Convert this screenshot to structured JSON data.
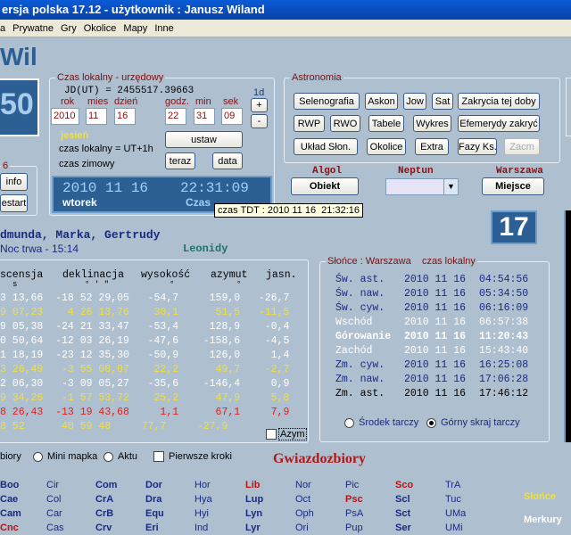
{
  "title": "ersja polska 17.12 - użytkownik : Janusz Wiland",
  "menu": [
    "a",
    "Prywatne",
    "Gry",
    "Okolice",
    "Mapy",
    "Inne"
  ],
  "logo": "Wil",
  "big_num": "50",
  "side_num": "6",
  "side_btns": [
    "info",
    "estart"
  ],
  "local_time": {
    "label": "Czas lokalny - urzędowy",
    "jd": "JD(UT)  =  2455517.39663",
    "rok": "rok",
    "mies": "mies",
    "dzien": "dzień",
    "godz": "godz.",
    "min": "min",
    "sek": "sek",
    "step": "1d",
    "year": "2010",
    "month": "11",
    "day": "16",
    "hour": "22",
    "minute": "31",
    "second": "09",
    "season": "jesień",
    "ut": "czas lokalny = UT+1h",
    "winter": "czas zimowy",
    "set_btn": "ustaw",
    "now_btn": "teraz",
    "date_btn": "data",
    "plus": "+",
    "minus": "-"
  },
  "display": {
    "date": "2010 11 16",
    "time": "22:31:09",
    "weekday": "wtorek",
    "tail": "Czas"
  },
  "tooltip": "czas TDT : 2010 11 16  21:32:16",
  "astro": {
    "label": "Astronomia",
    "row1": [
      "Selenografia",
      "Askon",
      "Jow",
      "Sat",
      "Zakrycia tej doby"
    ],
    "row2": [
      "RWP",
      "RWO",
      "Tabele",
      "Wykres",
      "Efemerydy zakryć"
    ],
    "row3": [
      "Układ Słon.",
      "Okolice",
      "Extra",
      "Fazy Ks.",
      "Zacm"
    ]
  },
  "selectors": {
    "algol": "Algol",
    "obiekt": "Obiekt",
    "neptun": "Neptun",
    "warszawa": "Warszawa",
    "miejsce": "Miejsce",
    "day_box": "17"
  },
  "names": "dmunda, Marka, Gertrudy",
  "night": "Noc trwa - 15:14",
  "leonidy": "Leonidy",
  "table": {
    "headers": [
      "scensja",
      "deklinacja",
      "wysokość",
      "azymut",
      "jasn."
    ],
    "units": [
      "s",
      "°  '  \"",
      "°",
      "°",
      ""
    ],
    "rows": [
      {
        "c": "#fff",
        "t": "3 13,66  -18 52 29,05   -54,7     159,0   -26,7"
      },
      {
        "c": "#f0e040",
        "t": "9 07,23    4 26 13,76    30,1      51,5   -11,5"
      },
      {
        "c": "#fff",
        "t": "9 05,38  -24 21 33,47   -53,4     128,9    -0,4"
      },
      {
        "c": "#fff",
        "t": "0 50,64  -12 03 26,19   -47,6    -158,6    -4,5"
      },
      {
        "c": "#fff",
        "t": "1 18,19  -23 12 35,30   -50,9     126,0     1,4"
      },
      {
        "c": "#f0e040",
        "t": "3 26,49   -3 55 08,07    22,2      49,7    -2,7"
      },
      {
        "c": "#fff",
        "t": "2 06,30   -3 09 05,27   -35,6    -146,4     0,9"
      },
      {
        "c": "#f0e040",
        "t": "9 34,26   -1 57 53,72    25,2      47,9     5,8"
      },
      {
        "c": "#e02020",
        "t": "8 26,43  -13 19 43,68     1,1      67,1     7,9"
      },
      {
        "c": "#f0e040",
        "t": "8 52      40 59 48     77,7     -27,9"
      }
    ],
    "azym": "Azym"
  },
  "sun": {
    "label": "Słońce : Warszawa    czas lokalny",
    "rows": [
      {
        "n": "Św. ast.",
        "d": "2010 11 16",
        "t": "04:54:56",
        "c": "#1a2a80"
      },
      {
        "n": "Św. naw.",
        "d": "2010 11 16",
        "t": "05:34:50",
        "c": "#1a2a80"
      },
      {
        "n": "Św. cyw.",
        "d": "2010 11 16",
        "t": "06:16:09",
        "c": "#1a2a80"
      },
      {
        "n": "Wschód",
        "d": "2010 11 16",
        "t": "06:57:38",
        "c": "#fff"
      },
      {
        "n": "Górowanie",
        "d": "2010 11 16",
        "t": "11:20:43",
        "c": "#fff",
        "b": true
      },
      {
        "n": "Zachód",
        "d": "2010 11 16",
        "t": "15:43:40",
        "c": "#fff"
      },
      {
        "n": "Zm. cyw.",
        "d": "2010 11 16",
        "t": "16:25:08",
        "c": "#1a2a80"
      },
      {
        "n": "Zm. naw.",
        "d": "2010 11 16",
        "t": "17:06:28",
        "c": "#1a2a80"
      },
      {
        "n": "Zm. ast.",
        "d": "2010 11 16",
        "t": "17:46:12",
        "c": "#000"
      }
    ],
    "radio1": "Środek tarczy",
    "radio2": "Górny skraj tarczy"
  },
  "bottom": {
    "b1": "biory",
    "b2": "Mini mapka",
    "b3": "Aktu",
    "b4": "Pierwsze kroki",
    "gw": "Gwiazdozbiory"
  },
  "cons": [
    [
      "Boo",
      "Cae",
      "Cam",
      "Cnc"
    ],
    [
      "Cir",
      "Col",
      "Car",
      "Cas"
    ],
    [
      "Com",
      "CrA",
      "CrB",
      "Crv"
    ],
    [
      "Dor",
      "Dra",
      "Equ",
      "Eri"
    ],
    [
      "Hor",
      "Hya",
      "Hyi",
      "Ind"
    ],
    [
      "Lib",
      "Lup",
      "Lyn",
      "Lyr"
    ],
    [
      "Nor",
      "Oct",
      "Oph",
      "Ori"
    ],
    [
      "Pic",
      "Psc",
      "PsA",
      "Pup"
    ],
    [
      "Sco",
      "Scl",
      "Sct",
      "Ser"
    ],
    [
      "TrA",
      "Tuc",
      "UMa",
      "UMi"
    ]
  ],
  "cons_colors": [
    [
      "#1a2a80",
      "#1a2a80",
      "#1a2a80",
      "#c01010"
    ],
    [
      "#1a2a80",
      "#1a2a80",
      "#1a2a80",
      "#1a2a80"
    ],
    [
      "#1a2a80",
      "#1a2a80",
      "#1a2a80",
      "#1a2a80"
    ],
    [
      "#1a2a80",
      "#1a2a80",
      "#1a2a80",
      "#1a2a80"
    ],
    [
      "#1a2a80",
      "#1a2a80",
      "#1a2a80",
      "#1a2a80"
    ],
    [
      "#c01010",
      "#1a2a80",
      "#1a2a80",
      "#1a2a80"
    ],
    [
      "#1a2a80",
      "#1a2a80",
      "#1a2a80",
      "#1a2a80"
    ],
    [
      "#1a2a80",
      "#c01010",
      "#1a2a80",
      "#1a2a80"
    ],
    [
      "#c01010",
      "#1a2a80",
      "#1a2a80",
      "#1a2a80"
    ],
    [
      "#1a2a80",
      "#1a2a80",
      "#1a2a80",
      "#1a2a80"
    ]
  ],
  "sol": "Słońce",
  "merk": "Merkury"
}
